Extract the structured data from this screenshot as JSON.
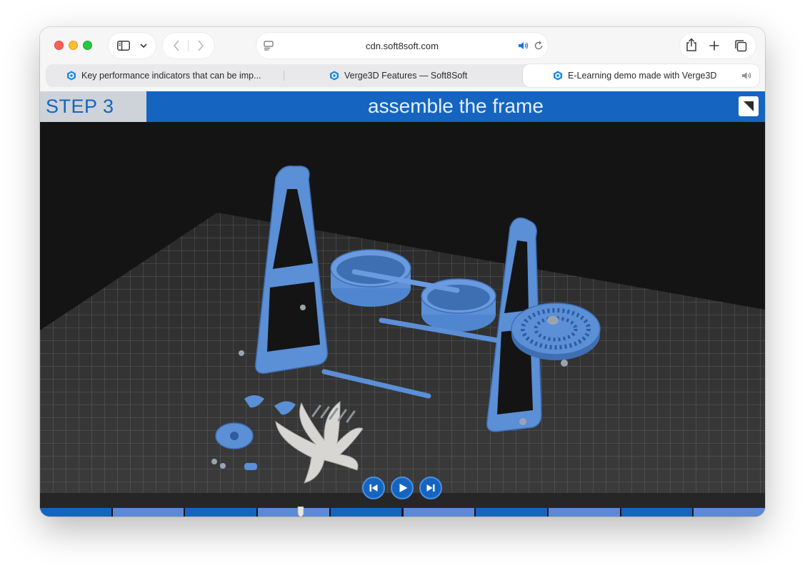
{
  "browser": {
    "address": "cdn.soft8soft.com",
    "icons": {
      "sidebar": "sidebar-icon",
      "chevron": "chevron-down-icon",
      "back": "back-arrow-icon",
      "forward": "forward-arrow-icon",
      "reader": "reader-icon",
      "audio": "speaker-icon",
      "reload": "reload-icon",
      "share": "share-icon",
      "new_tab": "plus-icon",
      "tabs_overview": "tabs-overview-icon"
    },
    "tabs": [
      {
        "label": "Key performance indicators that can be imp...",
        "active": false
      },
      {
        "label": "Verge3D Features — Soft8Soft",
        "active": false
      },
      {
        "label": "E-Learning demo made with Verge3D",
        "active": true,
        "audio": true
      }
    ]
  },
  "app": {
    "step_label": "STEP 3",
    "step_title": "assemble the frame",
    "accent": "#1565c0",
    "controls": {
      "prev": "skip-back-icon",
      "play": "play-icon",
      "next": "skip-forward-icon"
    },
    "timeline": {
      "segments": 10,
      "progress": 0.36
    }
  }
}
